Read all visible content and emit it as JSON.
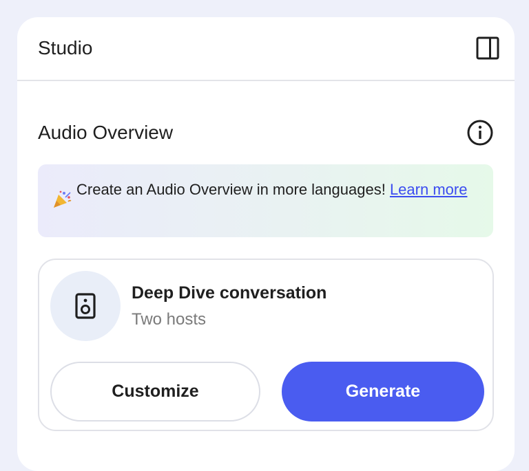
{
  "panel": {
    "title": "Studio",
    "toggle_icon": "side-panel-icon"
  },
  "audio_overview": {
    "title": "Audio Overview",
    "info_icon": "info-icon"
  },
  "banner": {
    "icon": "party-popper-icon",
    "text": "Create an Audio Overview in more languages!",
    "link_label": "Learn more"
  },
  "card": {
    "icon": "speaker-icon",
    "title": "Deep Dive conversation",
    "subtitle": "Two hosts",
    "customize_label": "Customize",
    "generate_label": "Generate"
  },
  "colors": {
    "accent": "#4a5cf0",
    "link": "#3b4cf0",
    "page_background": "#eef0fa"
  }
}
